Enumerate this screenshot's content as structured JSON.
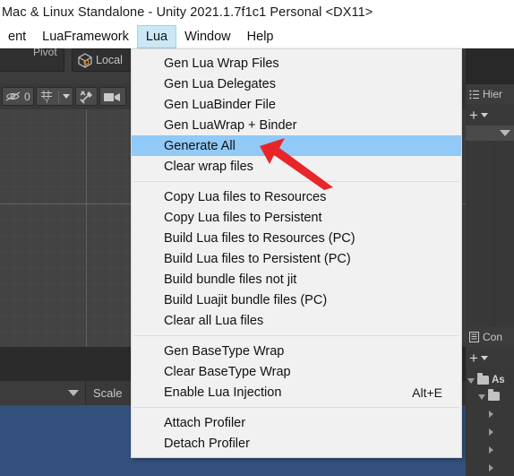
{
  "window": {
    "title": "Mac & Linux Standalone - Unity 2021.1.7f1c1 Personal <DX11>"
  },
  "menubar": {
    "items": [
      {
        "label": "ent",
        "active": false
      },
      {
        "label": "LuaFramework",
        "active": false
      },
      {
        "label": "Lua",
        "active": true
      },
      {
        "label": "Window",
        "active": false
      },
      {
        "label": "Help",
        "active": false
      }
    ]
  },
  "lua_menu": {
    "groups": [
      {
        "items": [
          {
            "label": "Gen Lua Wrap Files",
            "shortcut": "",
            "selected": false
          },
          {
            "label": "Gen Lua Delegates",
            "shortcut": "",
            "selected": false
          },
          {
            "label": "Gen LuaBinder File",
            "shortcut": "",
            "selected": false
          },
          {
            "label": "Gen LuaWrap + Binder",
            "shortcut": "",
            "selected": false
          },
          {
            "label": "Generate All",
            "shortcut": "",
            "selected": true
          },
          {
            "label": "Clear wrap files",
            "shortcut": "",
            "selected": false
          }
        ]
      },
      {
        "items": [
          {
            "label": "Copy Lua  files to Resources",
            "shortcut": "",
            "selected": false
          },
          {
            "label": "Copy Lua  files to Persistent",
            "shortcut": "",
            "selected": false
          },
          {
            "label": "Build Lua files to Resources (PC)",
            "shortcut": "",
            "selected": false
          },
          {
            "label": "Build Lua files to Persistent (PC)",
            "shortcut": "",
            "selected": false
          },
          {
            "label": "Build bundle files not jit",
            "shortcut": "",
            "selected": false
          },
          {
            "label": "Build Luajit bundle files  (PC)",
            "shortcut": "",
            "selected": false
          },
          {
            "label": "Clear all Lua files",
            "shortcut": "",
            "selected": false
          }
        ]
      },
      {
        "items": [
          {
            "label": "Gen BaseType Wrap",
            "shortcut": "",
            "selected": false
          },
          {
            "label": "Clear BaseType Wrap",
            "shortcut": "",
            "selected": false
          },
          {
            "label": "Enable Lua Injection",
            "shortcut": "Alt+E",
            "selected": false
          }
        ]
      },
      {
        "items": [
          {
            "label": "Attach Profiler",
            "shortcut": "",
            "selected": false
          },
          {
            "label": "Detach Profiler",
            "shortcut": "",
            "selected": false
          }
        ]
      }
    ],
    "highlight_color": "#91c9f7",
    "background_color": "#f1f1f1"
  },
  "scene_toolbar": {
    "pivot_label": "Pivot",
    "local_label": "Local",
    "hidden_count": "0"
  },
  "scene_footer": {
    "scale_label": "Scale"
  },
  "hierarchy_panel": {
    "tab_label": "Hier",
    "add_label": "+"
  },
  "project_panel": {
    "tab_label": "Con",
    "add_label": "+",
    "tree": [
      {
        "label": "As",
        "depth": 0,
        "expanded": true,
        "folder": true
      },
      {
        "label": "",
        "depth": 1,
        "expanded": true,
        "folder": true
      },
      {
        "label": "",
        "depth": 2,
        "expanded": false,
        "folder": false
      },
      {
        "label": "",
        "depth": 2,
        "expanded": false,
        "folder": false
      },
      {
        "label": "",
        "depth": 2,
        "expanded": false,
        "folder": false
      },
      {
        "label": "",
        "depth": 2,
        "expanded": false,
        "folder": false
      }
    ]
  },
  "annotation": {
    "arrow_color": "#e8262a",
    "arrow_name": "red-pointer-arrow"
  },
  "colors": {
    "unity_bg": "#383838",
    "viewport": "#434343",
    "selection_blue": "#33517c",
    "menu_highlight": "#91c9f7",
    "menubar_active": "#cce8f7"
  }
}
